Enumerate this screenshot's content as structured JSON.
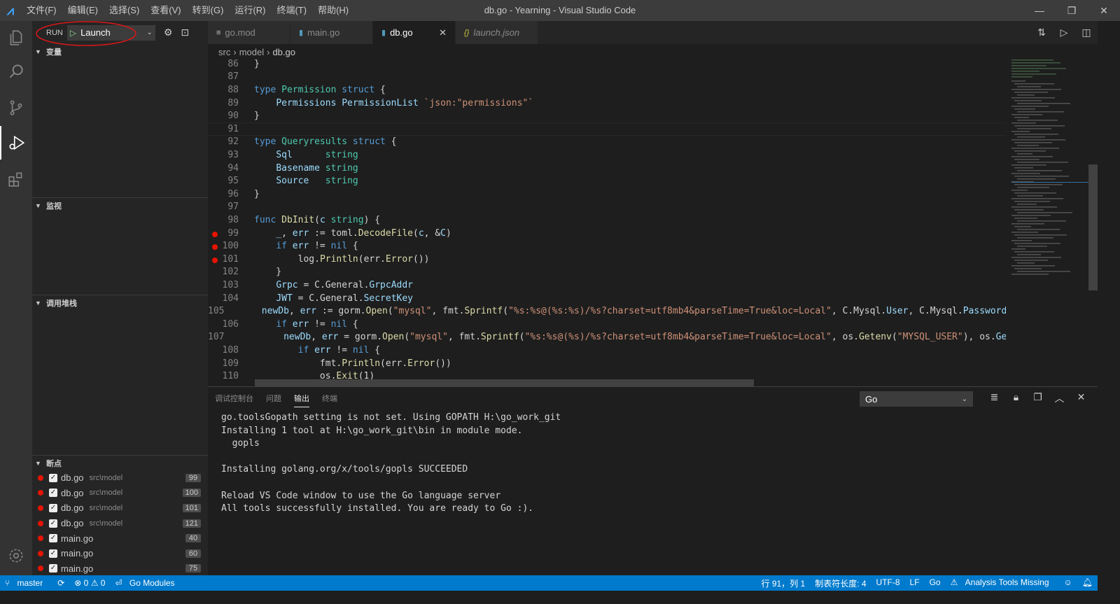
{
  "titlebar": {
    "menus": [
      "文件(F)",
      "编辑(E)",
      "选择(S)",
      "查看(V)",
      "转到(G)",
      "运行(R)",
      "终端(T)",
      "帮助(H)"
    ],
    "title": "db.go - Yearning - Visual Studio Code"
  },
  "sidebar": {
    "run_label": "RUN",
    "launch_config": "Launch",
    "sections": {
      "variables": "变量",
      "watch": "监视",
      "callstack": "调用堆栈",
      "breakpoints": "断点"
    },
    "breakpoints": [
      {
        "file": "db.go",
        "path": "src\\model",
        "line": "99"
      },
      {
        "file": "db.go",
        "path": "src\\model",
        "line": "100"
      },
      {
        "file": "db.go",
        "path": "src\\model",
        "line": "101"
      },
      {
        "file": "db.go",
        "path": "src\\model",
        "line": "121"
      },
      {
        "file": "main.go",
        "path": "",
        "line": "40"
      },
      {
        "file": "main.go",
        "path": "",
        "line": "60"
      },
      {
        "file": "main.go",
        "path": "",
        "line": "75"
      }
    ]
  },
  "tabs": [
    {
      "label": "go.mod",
      "icon": "≡"
    },
    {
      "label": "main.go",
      "icon": "▮"
    },
    {
      "label": "db.go",
      "icon": "▮"
    },
    {
      "label": "launch.json",
      "icon": "{}"
    }
  ],
  "breadcrumb": {
    "parts": [
      "src",
      "model",
      "db.go"
    ]
  },
  "editor": {
    "lines": [
      {
        "n": "86",
        "t": "}"
      },
      {
        "n": "87",
        "t": ""
      },
      {
        "n": "88",
        "t": "type Permission struct {"
      },
      {
        "n": "89",
        "t": "    Permissions PermissionList `json:\"permissions\"`"
      },
      {
        "n": "90",
        "t": "}"
      },
      {
        "n": "91",
        "t": ""
      },
      {
        "n": "92",
        "t": "type Queryresults struct {"
      },
      {
        "n": "93",
        "t": "    Sql      string"
      },
      {
        "n": "94",
        "t": "    Basename string"
      },
      {
        "n": "95",
        "t": "    Source   string"
      },
      {
        "n": "96",
        "t": "}"
      },
      {
        "n": "97",
        "t": ""
      },
      {
        "n": "98",
        "t": "func DbInit(c string) {"
      },
      {
        "n": "99",
        "t": "    _, err := toml.DecodeFile(c, &C)",
        "bp": true
      },
      {
        "n": "100",
        "t": "    if err != nil {",
        "bp": true
      },
      {
        "n": "101",
        "t": "        log.Println(err.Error())",
        "bp": true
      },
      {
        "n": "102",
        "t": "    }"
      },
      {
        "n": "103",
        "t": "    Grpc = C.General.GrpcAddr"
      },
      {
        "n": "104",
        "t": "    JWT = C.General.SecretKey"
      },
      {
        "n": "105",
        "t": "    newDb, err := gorm.Open(\"mysql\", fmt.Sprintf(\"%s:%s@(%s:%s)/%s?charset=utf8mb4&parseTime=True&loc=Local\", C.Mysql.User, C.Mysql.Password, C"
      },
      {
        "n": "106",
        "t": "    if err != nil {"
      },
      {
        "n": "107",
        "t": "        newDb, err = gorm.Open(\"mysql\", fmt.Sprintf(\"%s:%s@(%s)/%s?charset=utf8mb4&parseTime=True&loc=Local\", os.Getenv(\"MYSQL_USER\"), os.Geten"
      },
      {
        "n": "108",
        "t": "        if err != nil {"
      },
      {
        "n": "109",
        "t": "            fmt.Println(err.Error())"
      },
      {
        "n": "110",
        "t": "            os.Exit(1)"
      }
    ]
  },
  "panel": {
    "tabs": [
      "调试控制台",
      "问题",
      "输出",
      "终端"
    ],
    "active_tab": "输出",
    "channel": "Go",
    "output": [
      "go.toolsGopath setting is not set. Using GOPATH H:\\go_work_git",
      "Installing 1 tool at H:\\go_work_git\\bin in module mode.",
      "  gopls",
      "",
      "Installing golang.org/x/tools/gopls SUCCEEDED",
      "",
      "Reload VS Code window to use the Go language server",
      "All tools successfully installed. You are ready to Go :)."
    ]
  },
  "statusbar": {
    "branch": "master",
    "errors": "⊗ 0 ⚠ 0",
    "modules": "Go Modules",
    "position": "行 91，列 1",
    "tabsize": "制表符长度: 4",
    "encoding": "UTF-8",
    "eol": "LF",
    "language": "Go",
    "warning": "Analysis Tools Missing"
  }
}
